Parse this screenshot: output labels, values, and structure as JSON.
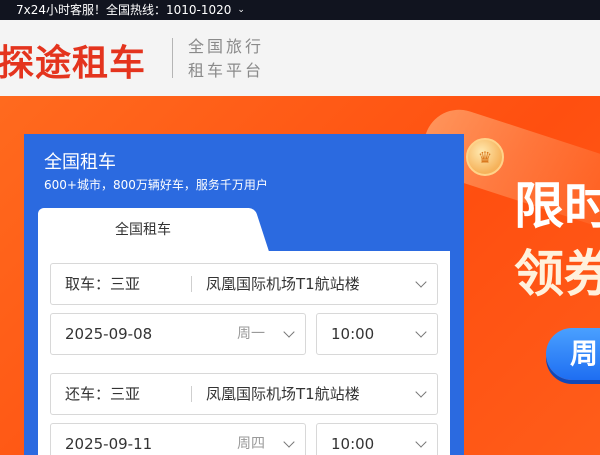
{
  "topbar": {
    "service_text": "7x24小时客服！全国热线：1010-1020"
  },
  "header": {
    "logo_text": "探途租车",
    "slogan_line1": "全国旅行",
    "slogan_line2": "租车平台"
  },
  "promo": {
    "line1": "限时",
    "line2": "领券",
    "button_label": "周"
  },
  "panel": {
    "title": "全国租车",
    "subtitle": "600+城市，800万辆好车，服务千万用户",
    "tab_label": "全国租车",
    "pickup": {
      "label": "取车：",
      "city": "三亚",
      "place": "凤凰国际机场T1航站楼",
      "date": "2025-09-08",
      "weekday": "周一",
      "time": "10:00"
    },
    "return": {
      "label": "还车：",
      "city": "三亚",
      "place": "凤凰国际机场T1航站楼",
      "date": "2025-09-11",
      "weekday": "周四",
      "time": "10:00"
    }
  },
  "colors": {
    "brand_red": "#e4341e",
    "panel_blue": "#2b6ae0",
    "hero_orange": "#ff5a1f",
    "topbar_bg": "#11141f"
  }
}
